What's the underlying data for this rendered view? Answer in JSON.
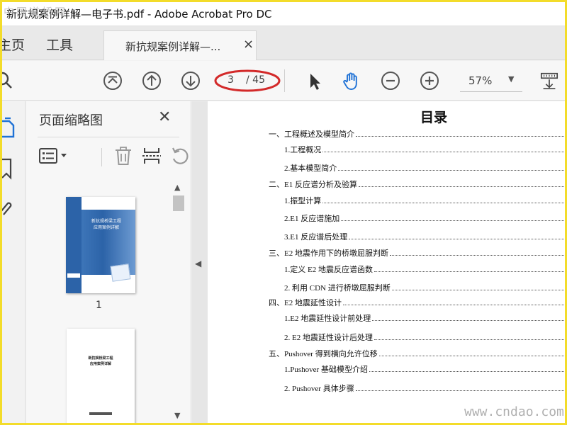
{
  "window": {
    "title": "新抗规案例详解—电子书.pdf - Adobe Acrobat Pro DC"
  },
  "watermark_top": "中国道桥网",
  "watermark_bottom": "www.cndao.com",
  "nav": {
    "home": "主页",
    "tools": "工具"
  },
  "document_tab": {
    "label": "新抗规案例详解—...",
    "close": "×"
  },
  "toolbar": {
    "icons": [
      "search-icon",
      "first-page-icon",
      "previous-page-icon",
      "next-page-icon",
      "select-icon",
      "hand-icon",
      "zoom-out-icon",
      "zoom-in-icon",
      "scroll-mode-icon"
    ],
    "page_current": "3",
    "page_total": "/ 45",
    "zoom": "57%",
    "annotation_color": "#d32a2a",
    "hand_color": "#1f72d6"
  },
  "thumbnail_pane": {
    "title": "页面缩略图",
    "close": "✕",
    "tools": [
      "options-icon",
      "delete-icon",
      "split-icon",
      "rotate-icon"
    ],
    "pages": [
      {
        "label": "1",
        "cover_title_line1": "新抗规桥梁工程",
        "cover_title_line2": "应用案例详解"
      },
      {
        "label": "",
        "cover_title_line1": "新抗规桥梁工程",
        "cover_title_line2": "应用案例详解"
      }
    ]
  },
  "toc": {
    "title": "目录",
    "entries": [
      {
        "text": "一、工程概述及模型简介",
        "level": 0
      },
      {
        "text": "1.工程概况",
        "level": 1
      },
      {
        "text": "2.基本模型简介",
        "level": 1
      },
      {
        "text": "二、E1 反应谱分析及验算",
        "level": 0
      },
      {
        "text": "1.振型计算",
        "level": 1
      },
      {
        "text": "2.E1 反应谱施加",
        "level": 1
      },
      {
        "text": "3.E1 反应谱后处理",
        "level": 1
      },
      {
        "text": "三、E2 地震作用下的桥墩屈服判断",
        "level": 0
      },
      {
        "text": "1.定义 E2 地震反应谱函数",
        "level": 1
      },
      {
        "text": "2. 利用 CDN 进行桥墩屈服判断",
        "level": 1
      },
      {
        "text": "四、E2 地震延性设计",
        "level": 0
      },
      {
        "text": "1.E2 地震延性设计前处理",
        "level": 1
      },
      {
        "text": "2. E2 地震延性设计后处理",
        "level": 1
      },
      {
        "text": "五、Pushover 得到横向允许位移",
        "level": 0
      },
      {
        "text": "1.Pushover 基础模型介绍",
        "level": 1
      },
      {
        "text": "2. Pushover 具体步骤",
        "level": 1
      }
    ]
  },
  "colors": {
    "frame": "#f3dc2a",
    "accent": "#2c63a8"
  }
}
